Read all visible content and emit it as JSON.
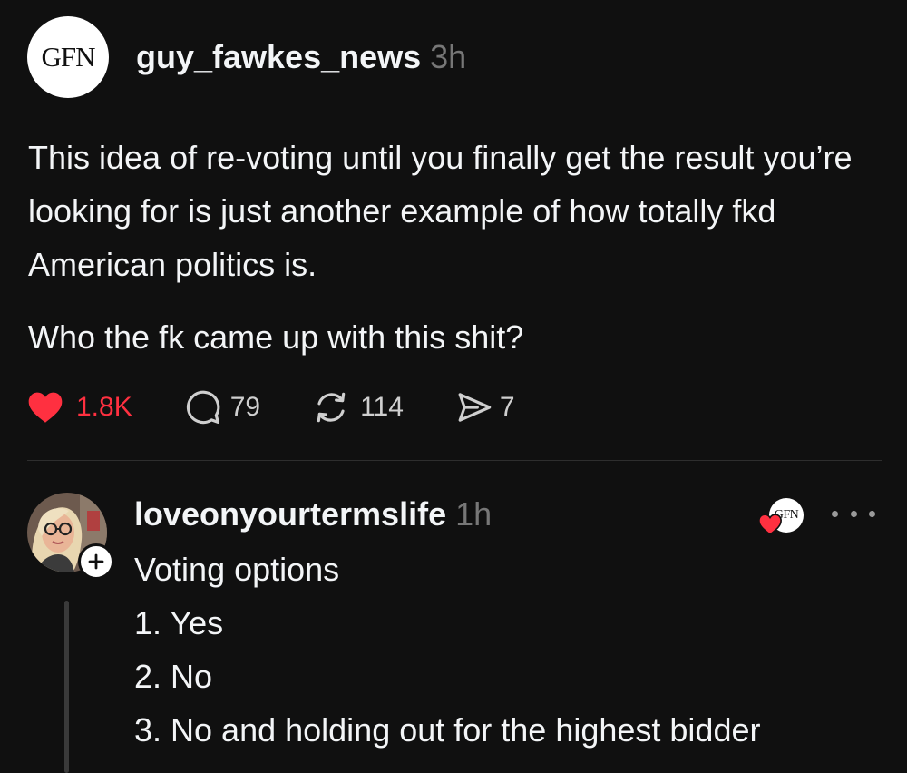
{
  "post": {
    "avatar_text": "GFN",
    "author": "guy_fawkes_news",
    "time": "3h",
    "body": [
      "This idea of re-voting until you finally get the result you’re looking for is just another example of how totally fkd American politics is.",
      "Who the fk came up with this shit?"
    ],
    "actions": {
      "likes": "1.8K",
      "replies": "79",
      "reposts": "114",
      "shares": "7"
    }
  },
  "reply": {
    "author": "loveonyourtermslife",
    "time": "1h",
    "liked_by_avatar_text": "GFN",
    "lines": [
      "Voting options",
      "1. Yes",
      "2. No",
      "3. No and holding out for the highest bidder"
    ]
  },
  "icons": {
    "like": "heart-icon",
    "reply": "comment-bubble-icon",
    "repost": "repost-arrows-icon",
    "share": "send-icon",
    "more": "more-dots-icon",
    "follow": "plus-icon"
  },
  "colors": {
    "background": "#101010",
    "text": "#f3f5f7",
    "muted": "#777777",
    "like_red": "#ff3040",
    "divider": "#2e2e2e"
  }
}
